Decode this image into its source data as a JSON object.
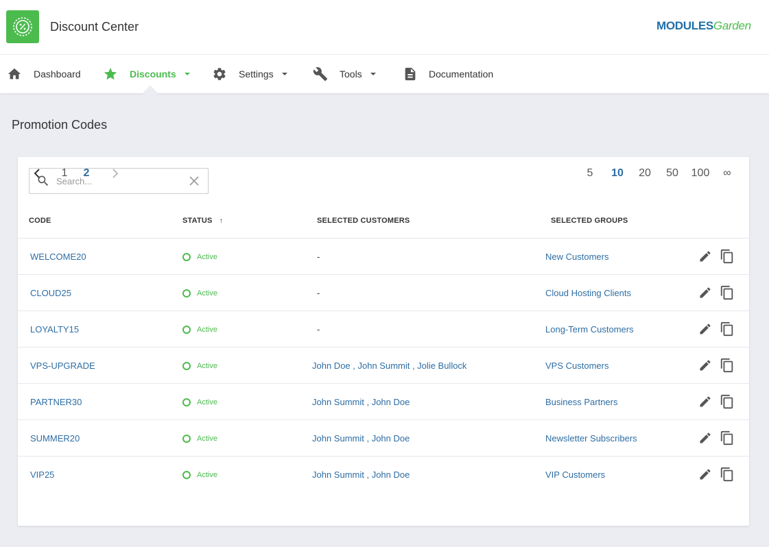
{
  "header": {
    "app_title": "Discount Center",
    "brand_part1": "MODULES",
    "brand_part2": "Garden"
  },
  "nav": [
    {
      "label": "Dashboard",
      "icon": "home-icon"
    },
    {
      "label": "Discounts",
      "icon": "star-icon",
      "active": true
    },
    {
      "label": "Settings",
      "icon": "gear-icon"
    },
    {
      "label": "Tools",
      "icon": "wrench-icon"
    },
    {
      "label": "Documentation",
      "icon": "document-icon"
    }
  ],
  "page": {
    "title": "Promotion Codes"
  },
  "search": {
    "placeholder": "Search..."
  },
  "table": {
    "columns": [
      "CODE",
      "STATUS",
      "SELECTED CUSTOMERS",
      "SELECTED GROUPS"
    ],
    "sort_indicator": "↑",
    "rows": [
      {
        "code": "WELCOME20",
        "status": "Active",
        "customers": "-",
        "group": "New Customers"
      },
      {
        "code": "CLOUD25",
        "status": "Active",
        "customers": "-",
        "group": "Cloud Hosting Clients"
      },
      {
        "code": "LOYALTY15",
        "status": "Active",
        "customers": "-",
        "group": "Long-Term Customers"
      },
      {
        "code": "VPS-UPGRADE",
        "status": "Active",
        "customers": "John Doe , John Summit , Jolie Bullock",
        "group": "VPS Customers"
      },
      {
        "code": "PARTNER30",
        "status": "Active",
        "customers": "John Summit , John Doe",
        "group": "Business Partners"
      },
      {
        "code": "SUMMER20",
        "status": "Active",
        "customers": "John Summit , John Doe",
        "group": "Newsletter Subscribers"
      },
      {
        "code": "VIP25",
        "status": "Active",
        "customers": "John Summit , John Doe",
        "group": "VIP Customers"
      }
    ]
  },
  "pagination": {
    "pages": [
      "1",
      "2"
    ],
    "current_page": "2",
    "page_sizes": [
      "5",
      "10",
      "20",
      "50",
      "100",
      "∞"
    ],
    "current_size": "10"
  },
  "colors": {
    "accent": "#4cbb4e",
    "link": "#2e6da4",
    "background": "#ebedf2"
  }
}
